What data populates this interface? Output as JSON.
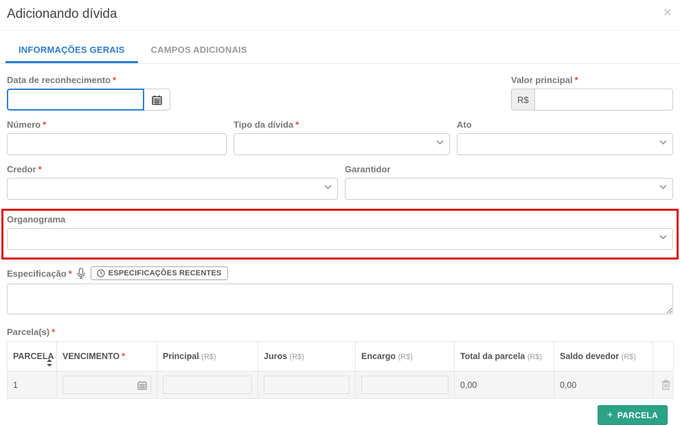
{
  "modal": {
    "title": "Adicionando dívida",
    "close_glyph": "×"
  },
  "tabs": [
    {
      "label": "INFORMAÇÕES GERAIS",
      "active": true
    },
    {
      "label": "CAMPOS ADICIONAIS",
      "active": false
    }
  ],
  "fields": {
    "data_reconhecimento": {
      "label": "Data de reconhecimento",
      "required": "*",
      "value": "",
      "placeholder": ""
    },
    "valor_principal": {
      "label": "Valor principal",
      "required": "*",
      "prefix": "R$",
      "value": "",
      "placeholder": ""
    },
    "numero": {
      "label": "Número",
      "required": "*",
      "value": "",
      "placeholder": ""
    },
    "tipo_divida": {
      "label": "Tipo da dívida",
      "required": "*",
      "selected_value": ""
    },
    "ato": {
      "label": "Ato",
      "selected_value": ""
    },
    "credor": {
      "label": "Credor",
      "required": "*",
      "selected_value": ""
    },
    "garantidor": {
      "label": "Garantidor",
      "selected_value": ""
    },
    "organograma": {
      "label": "Organograma",
      "selected_value": "",
      "highlighted": true,
      "highlight_color": "#dd1111"
    },
    "especificacao": {
      "label": "Especificação",
      "required": "*",
      "value": "",
      "recent_button_label": "ESPECIFICAÇÕES RECENTES"
    }
  },
  "parcelas": {
    "label": "Parcela(s)",
    "required": "*",
    "table": {
      "headers": [
        {
          "label": "PARCELA"
        },
        {
          "label": "VENCIMENTO",
          "required": "*"
        },
        {
          "label": "Principal",
          "unit": "(R$)"
        },
        {
          "label": "Juros",
          "unit": "(R$)"
        },
        {
          "label": "Encargo",
          "unit": "(R$)"
        },
        {
          "label": "Total da parcela",
          "unit": "(R$)"
        },
        {
          "label": "Saldo devedor",
          "unit": "(R$)"
        },
        {
          "label": ""
        }
      ],
      "rows": [
        {
          "parcela": "1",
          "vencimento": "",
          "principal": "",
          "juros": "",
          "encargo": "",
          "total": "0,00",
          "saldo": "0,00"
        }
      ]
    },
    "add_button": {
      "icon": "+",
      "label": "PARCELA"
    }
  },
  "colors": {
    "accent_blue": "#2d7cd2",
    "highlight_red": "#dd1111",
    "button_green": "#2ca287"
  }
}
